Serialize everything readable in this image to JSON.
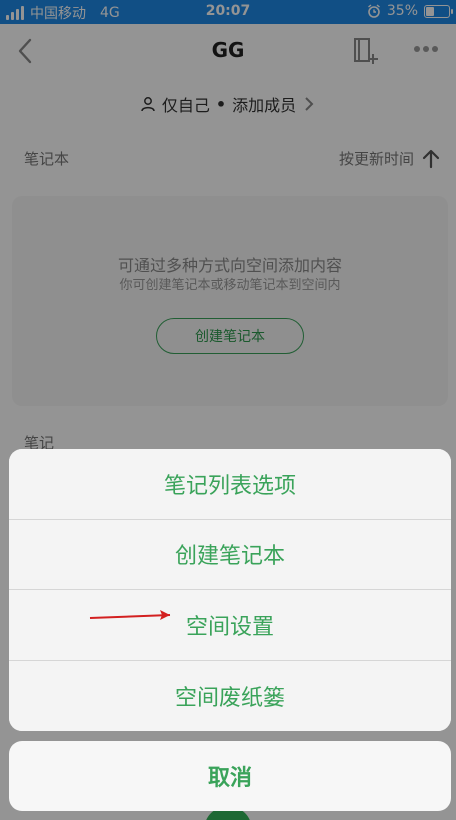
{
  "status_bar": {
    "carrier": "中国移动",
    "network": "4G",
    "time": "20:07",
    "battery": "35%",
    "battery_level": 0.35,
    "bar_color": "#1e88e5"
  },
  "navbar": {
    "title": "GG",
    "icons": [
      "chevron-left-icon",
      "add-page-icon",
      "more-icon"
    ]
  },
  "members": {
    "scope": "仅自己",
    "separator": "•",
    "add_label": "添加成员"
  },
  "notebook_section": {
    "label": "笔记本",
    "sort_label": "按更新时间"
  },
  "empty_state": {
    "title": "可通过多种方式向空间添加内容",
    "subtitle": "你可创建笔记本或移动笔记本到空间内",
    "create_button": "创建笔记本"
  },
  "notes_section": {
    "label": "笔记"
  },
  "action_sheet": {
    "items": [
      {
        "label": "笔记列表选项"
      },
      {
        "label": "创建笔记本"
      },
      {
        "label": "空间设置"
      },
      {
        "label": "空间废纸篓"
      }
    ],
    "cancel": "取消",
    "accent": "#3aa35a"
  },
  "annotation": {
    "arrow_color": "#d32020"
  }
}
